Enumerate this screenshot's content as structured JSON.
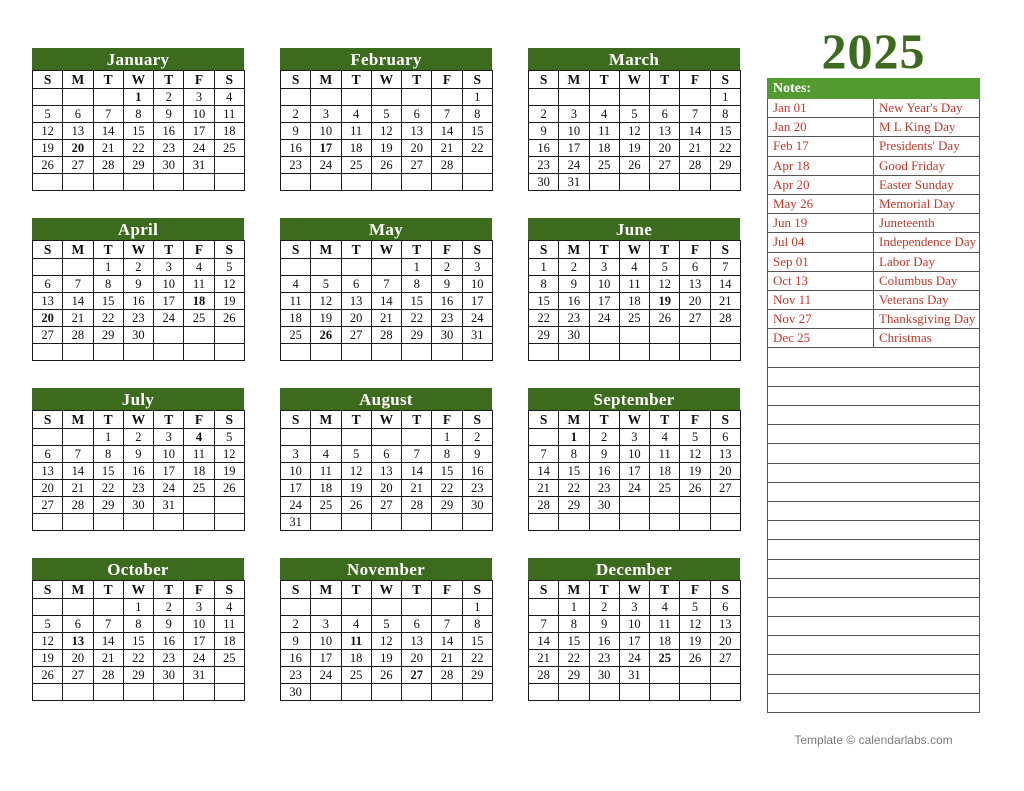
{
  "year": "2025",
  "footer": "Template © calendarlabs.com",
  "colors": {
    "month_header_green": "#3d6b1e",
    "notes_header_green": "#539b30",
    "weekend_green": "#3fae3f",
    "holiday_red": "#b01020",
    "notes_text_red": "#c0392b"
  },
  "weekday_headers": [
    "S",
    "M",
    "T",
    "W",
    "T",
    "F",
    "S"
  ],
  "notes": {
    "header": "Notes:",
    "holidays": [
      {
        "date": "Jan 01",
        "name": "New Year's Day"
      },
      {
        "date": "Jan 20",
        "name": "M L King Day"
      },
      {
        "date": "Feb 17",
        "name": "Presidents' Day"
      },
      {
        "date": "Apr 18",
        "name": "Good Friday"
      },
      {
        "date": "Apr 20",
        "name": "Easter Sunday"
      },
      {
        "date": "May 26",
        "name": "Memorial Day"
      },
      {
        "date": "Jun 19",
        "name": "Juneteenth"
      },
      {
        "date": "Jul 04",
        "name": "Independence Day"
      },
      {
        "date": "Sep 01",
        "name": "Labor Day"
      },
      {
        "date": "Oct 13",
        "name": "Columbus Day"
      },
      {
        "date": "Nov 11",
        "name": "Veterans Day"
      },
      {
        "date": "Nov 27",
        "name": "Thanksgiving Day"
      },
      {
        "date": "Dec 25",
        "name": "Christmas"
      }
    ],
    "blank_rows": 19
  },
  "months": [
    {
      "name": "January",
      "first_weekday": 3,
      "days": 31,
      "weeks": 6,
      "holidays": [
        1,
        20
      ],
      "weekends": [
        4,
        5,
        11,
        12,
        18,
        19,
        25,
        26
      ]
    },
    {
      "name": "February",
      "first_weekday": 6,
      "days": 28,
      "weeks": 6,
      "holidays": [
        17
      ],
      "weekends": [
        1,
        2,
        8,
        9,
        15,
        16,
        22,
        23
      ]
    },
    {
      "name": "March",
      "first_weekday": 6,
      "days": 31,
      "weeks": 6,
      "holidays": [],
      "weekends": [
        1,
        2,
        8,
        9,
        15,
        16,
        22,
        23,
        29,
        30
      ]
    },
    {
      "name": "April",
      "first_weekday": 2,
      "days": 30,
      "weeks": 6,
      "holidays": [
        18,
        20
      ],
      "weekends": [
        5,
        6,
        12,
        13,
        19,
        26,
        27
      ]
    },
    {
      "name": "May",
      "first_weekday": 4,
      "days": 31,
      "weeks": 6,
      "holidays": [
        26
      ],
      "weekends": [
        3,
        4,
        10,
        11,
        17,
        18,
        24,
        25,
        31
      ]
    },
    {
      "name": "June",
      "first_weekday": 0,
      "days": 30,
      "weeks": 6,
      "holidays": [
        19
      ],
      "weekends": [
        1,
        7,
        8,
        14,
        15,
        21,
        22,
        28,
        29
      ]
    },
    {
      "name": "July",
      "first_weekday": 2,
      "days": 31,
      "weeks": 6,
      "holidays": [
        4
      ],
      "weekends": [
        5,
        6,
        12,
        13,
        19,
        20,
        26,
        27
      ]
    },
    {
      "name": "August",
      "first_weekday": 5,
      "days": 31,
      "weeks": 6,
      "holidays": [],
      "weekends": [
        2,
        3,
        9,
        10,
        16,
        17,
        23,
        24,
        30,
        31
      ]
    },
    {
      "name": "September",
      "first_weekday": 1,
      "days": 30,
      "weeks": 6,
      "holidays": [
        1
      ],
      "weekends": [
        6,
        7,
        13,
        14,
        20,
        21,
        27,
        28
      ]
    },
    {
      "name": "October",
      "first_weekday": 3,
      "days": 31,
      "weeks": 6,
      "holidays": [
        13
      ],
      "weekends": [
        4,
        5,
        11,
        12,
        18,
        19,
        25,
        26
      ]
    },
    {
      "name": "November",
      "first_weekday": 6,
      "days": 30,
      "weeks": 6,
      "holidays": [
        11,
        27
      ],
      "weekends": [
        1,
        2,
        8,
        9,
        15,
        16,
        22,
        23,
        29,
        30
      ]
    },
    {
      "name": "December",
      "first_weekday": 1,
      "days": 31,
      "weeks": 6,
      "holidays": [
        25
      ],
      "weekends": [
        6,
        7,
        13,
        14,
        20,
        21,
        27,
        28
      ]
    }
  ]
}
